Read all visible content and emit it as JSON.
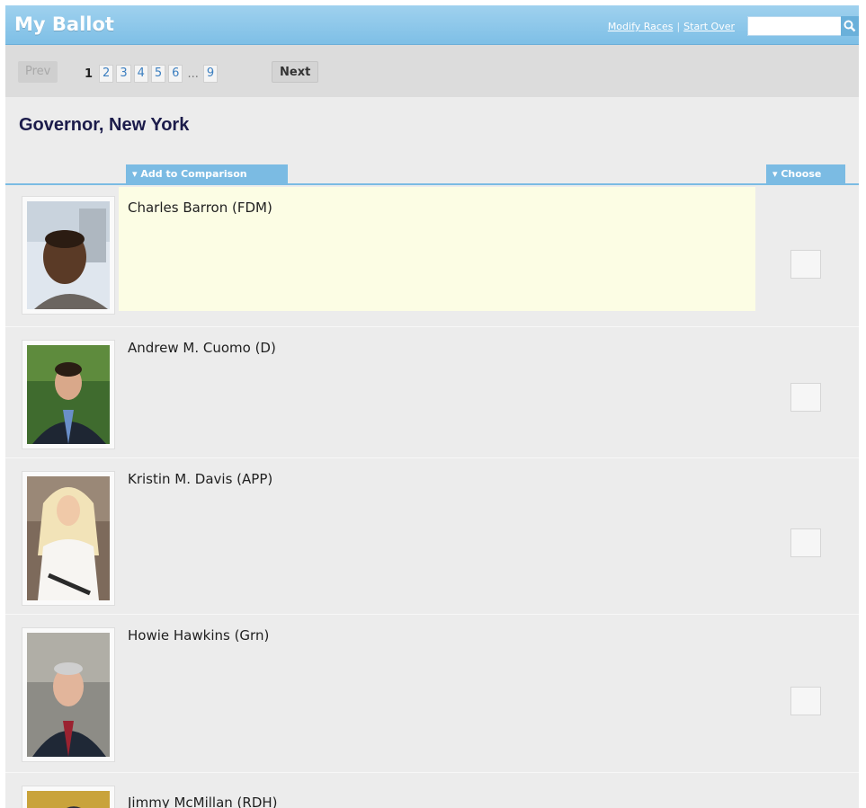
{
  "header": {
    "title": "My Ballot",
    "modify_races": "Modify Races",
    "separator": "|",
    "start_over": "Start Over",
    "search_placeholder": "",
    "search_icon": "search-icon"
  },
  "pager": {
    "prev": "Prev",
    "current": "1",
    "pages": [
      "2",
      "3",
      "4",
      "5",
      "6"
    ],
    "ellipsis": "...",
    "last": "9",
    "next": "Next"
  },
  "race": {
    "title": "Governor, New York"
  },
  "columns": {
    "add_to_comparison": "▾ Add to Comparison",
    "choose": "▾ Choose"
  },
  "candidates": [
    {
      "name": "Charles Barron (FDM)",
      "highlighted": true
    },
    {
      "name": "Andrew M. Cuomo (D)",
      "highlighted": false
    },
    {
      "name": "Kristin M. Davis (APP)",
      "highlighted": false
    },
    {
      "name": "Howie Hawkins (Grn)",
      "highlighted": false
    },
    {
      "name": "Jimmy McMillan (RDH)",
      "highlighted": false
    }
  ],
  "colors": {
    "header_blue": "#7ebfe6",
    "accent_blue": "#7bbbe3",
    "highlight_row": "#fcfde4",
    "page_link": "#3c7fc0",
    "title_navy": "#1b1b4a"
  }
}
